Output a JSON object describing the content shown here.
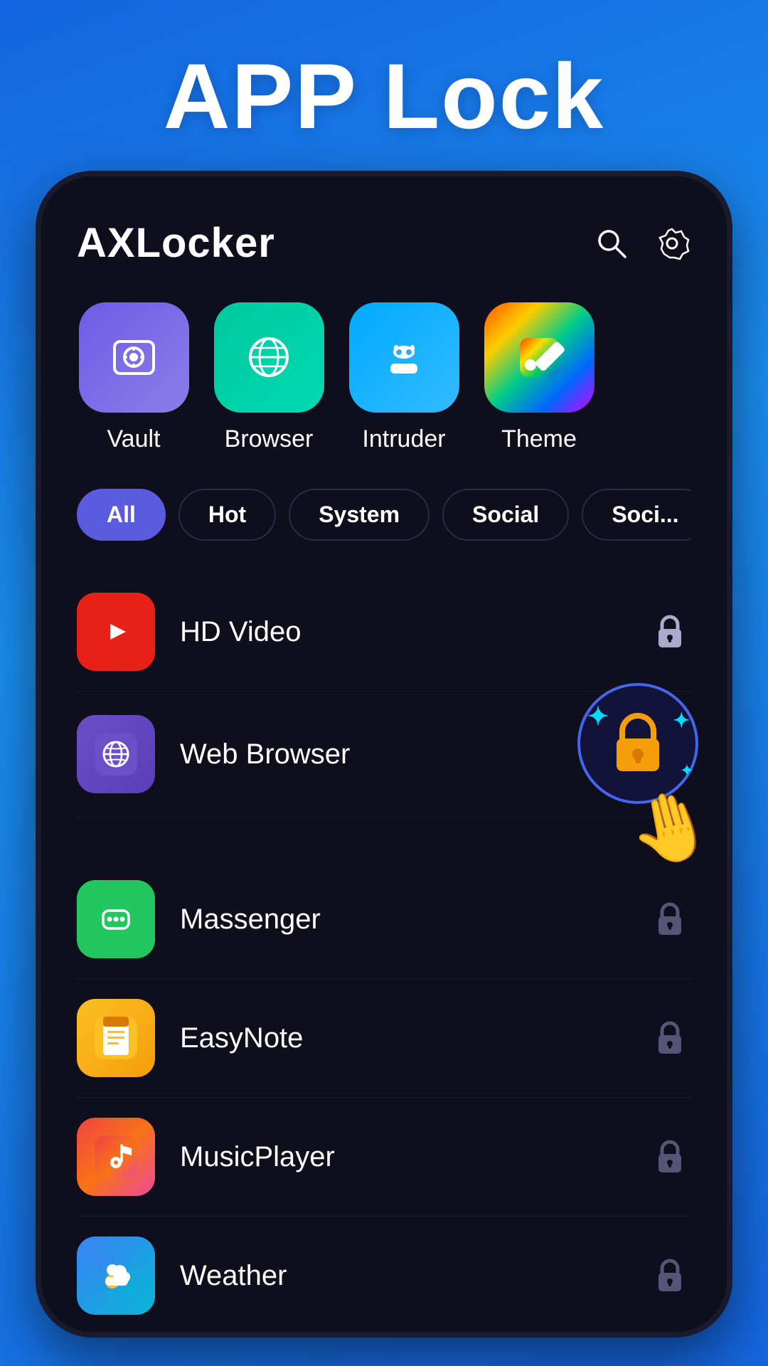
{
  "header": {
    "title": "APP Lock",
    "logo": "AXLocker"
  },
  "features": [
    {
      "id": "vault",
      "label": "Vault",
      "icon": "📷",
      "colorClass": "feature-icon-vault"
    },
    {
      "id": "browser",
      "label": "Browser",
      "icon": "🌐",
      "colorClass": "feature-icon-browser"
    },
    {
      "id": "intruder",
      "label": "Intruder",
      "icon": "🕵️",
      "colorClass": "feature-icon-intruder"
    },
    {
      "id": "theme",
      "label": "Theme",
      "icon": "🎨",
      "colorClass": "feature-icon-theme"
    }
  ],
  "filters": [
    {
      "id": "all",
      "label": "All",
      "active": true
    },
    {
      "id": "hot",
      "label": "Hot",
      "active": false
    },
    {
      "id": "system",
      "label": "System",
      "active": false
    },
    {
      "id": "social",
      "label": "Social",
      "active": false
    },
    {
      "id": "social2",
      "label": "Soci...",
      "active": false
    }
  ],
  "apps": [
    {
      "id": "hd-video",
      "name": "HD Video",
      "iconClass": "app-icon-youtube",
      "locked": false,
      "active": false
    },
    {
      "id": "web-browser",
      "name": "Web Browser",
      "iconClass": "app-icon-browser",
      "locked": true,
      "active": true
    },
    {
      "id": "messenger",
      "name": "Massenger",
      "iconClass": "app-icon-messenger",
      "locked": false,
      "active": false
    },
    {
      "id": "easy-note",
      "name": "EasyNote",
      "iconClass": "app-icon-note",
      "locked": false,
      "active": false
    },
    {
      "id": "music-player",
      "name": "MusicPlayer",
      "iconClass": "app-icon-music",
      "locked": false,
      "active": false
    },
    {
      "id": "weather",
      "name": "Weather",
      "iconClass": "app-icon-weather",
      "locked": false,
      "active": false
    }
  ],
  "icons": {
    "search": "search-icon",
    "settings": "settings-icon"
  }
}
